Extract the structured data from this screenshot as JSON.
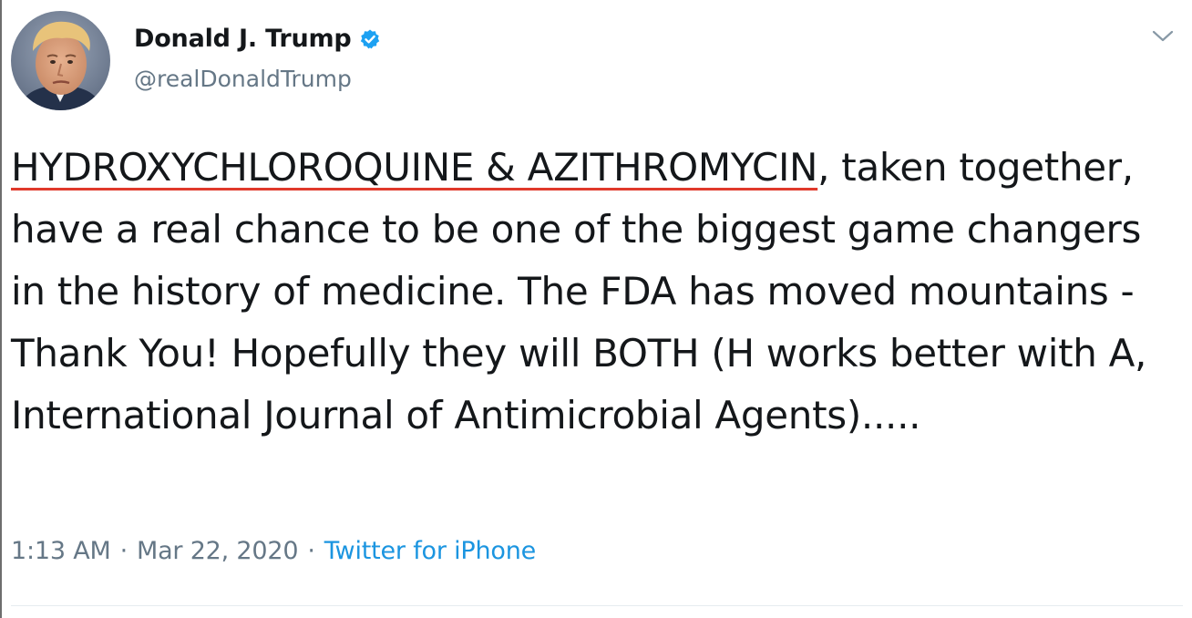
{
  "tweet": {
    "display_name": "Donald J. Trump",
    "handle": "@realDonaldTrump",
    "verified": true,
    "text_highlighted": "HYDROXYCHLOROQUINE & AZITHROMYCIN",
    "text_rest": ", taken together, have a real chance to be one of the biggest game changers in the history of medicine. The FDA has moved mountains - Thank You! Hopefully they will BOTH (H works better with A, International Journal of Antimicrobial Agents).....",
    "time": "1:13 AM",
    "separator": "·",
    "date": "Mar 22, 2020",
    "source": "Twitter for iPhone"
  },
  "icons": {
    "verified": "verified-badge-icon",
    "more": "chevron-down-icon"
  },
  "colors": {
    "link": "#1b95e0",
    "secondary_text": "#657786",
    "primary_text": "#14171a",
    "underline": "#e0392b",
    "verified": "#1da1f2"
  }
}
